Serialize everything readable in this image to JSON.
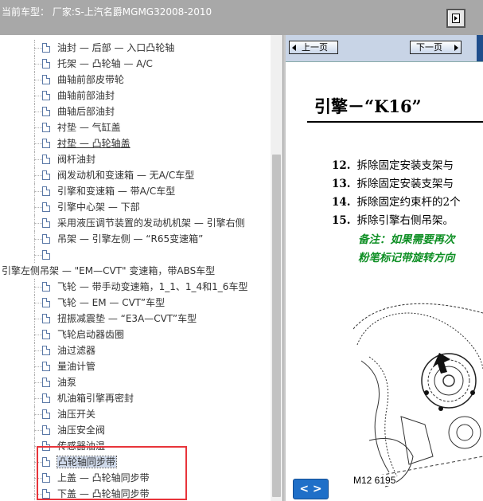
{
  "window": {
    "title": "当前车型： 厂家:S-上汽名爵MGMG32008-2010",
    "top_button_icon": "export-icon"
  },
  "tree": {
    "items": [
      {
        "label": "油封 — 后部 — 入口凸轮轴",
        "level": 1
      },
      {
        "label": "托架 — 凸轮轴 — A/C",
        "level": 1
      },
      {
        "label": "曲轴前部皮带轮",
        "level": 1
      },
      {
        "label": "曲轴前部油封",
        "level": 1
      },
      {
        "label": "曲轴后部油封",
        "level": 1
      },
      {
        "label": "衬垫 — 气缸盖",
        "level": 1
      },
      {
        "label": "衬垫 — 凸轮轴盖",
        "level": 1,
        "underlined": true
      },
      {
        "label": "阀杆油封",
        "level": 1
      },
      {
        "label": "阀发动机和变速箱 — 无A/C车型",
        "level": 1
      },
      {
        "label": "引擎和变速箱 — 带A/C车型",
        "level": 1
      },
      {
        "label": "引擎中心架 — 下部",
        "level": 1
      },
      {
        "label": "采用液压调节装置的发动机机架 — 引擎右侧",
        "level": 1
      },
      {
        "label": "吊架 — 引擎左侧 — “R65变速箱”",
        "level": 1
      },
      {
        "label": "",
        "level": 1
      },
      {
        "label": "引擎左侧吊架 — \"EM—CVT\" 变速箱，带ABS车型",
        "level": 0
      },
      {
        "label": "飞轮 — 带手动变速箱，1_1、1_4和1_6车型",
        "level": 1
      },
      {
        "label": "飞轮 — EM — CVT”车型",
        "level": 1
      },
      {
        "label": "扭振减震垫 — “E3A—CVT”车型",
        "level": 1
      },
      {
        "label": "飞轮启动器齿圈",
        "level": 1
      },
      {
        "label": "油过滤器",
        "level": 1
      },
      {
        "label": "量油计管",
        "level": 1
      },
      {
        "label": "油泵",
        "level": 1
      },
      {
        "label": "机油箱引擎再密封",
        "level": 1
      },
      {
        "label": "油压开关",
        "level": 1
      },
      {
        "label": "油压安全阀",
        "level": 1
      },
      {
        "label": "传感器油温",
        "level": 1
      },
      {
        "label": "凸轮轴同步带",
        "level": 1,
        "selected": true
      },
      {
        "label": "上盖 — 凸轮轴同步带",
        "level": 1
      },
      {
        "label": "下盖 — 凸轮轴同步带",
        "level": 1
      }
    ]
  },
  "doc": {
    "prev_label": "上一页",
    "next_label": "下一页",
    "title": "引擎－“K16”",
    "steps": [
      {
        "num": "12.",
        "text": "拆除固定安装支架与"
      },
      {
        "num": "13.",
        "text": "拆除固定安装支架与"
      },
      {
        "num": "14.",
        "text": "拆除固定约束杆的2个"
      },
      {
        "num": "15.",
        "text": "拆除引擎右侧吊架。"
      }
    ],
    "note_line1": "备注：如果需要再次",
    "note_line2": "粉笔标记带旋转方向",
    "figure_label": "M12 6195",
    "nav_arrows_label": "< >"
  },
  "colors": {
    "highlight_box": "#e8343a",
    "note_text": "#0e8f24",
    "nav_accent": "#1f6fc8"
  }
}
